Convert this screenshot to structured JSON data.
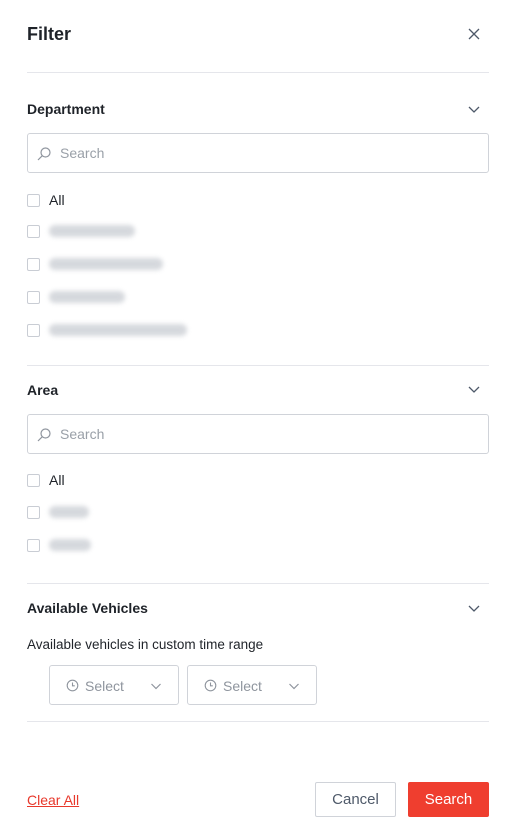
{
  "panel": {
    "title": "Filter",
    "close_icon": "close-icon"
  },
  "department": {
    "title": "Department",
    "search_placeholder": "Search",
    "all_label": "All",
    "blurred_option_count": 4
  },
  "area": {
    "title": "Area",
    "search_placeholder": "Search",
    "all_label": "All",
    "blurred_option_count": 2
  },
  "vehicles": {
    "title": "Available Vehicles",
    "subtitle": "Available vehicles in custom time range",
    "start_select": "Select",
    "end_select": "Select"
  },
  "footer": {
    "clear_all": "Clear All",
    "cancel": "Cancel",
    "search": "Search"
  },
  "colors": {
    "accent": "#ef3e2f",
    "link": "#e8382b"
  }
}
